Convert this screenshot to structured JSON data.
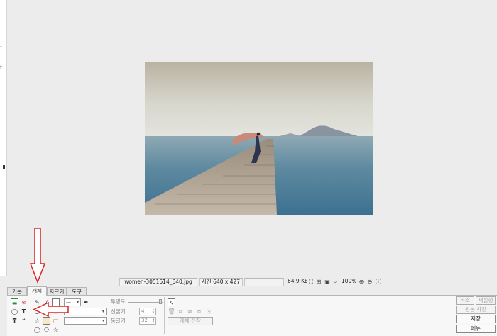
{
  "status": {
    "filename": "women-3051614_640.jpg",
    "dimensions": "사진 640 x 427",
    "filesize": "64.9 KB",
    "zoom": "100%"
  },
  "tabs": [
    {
      "label": "기본",
      "active": false
    },
    {
      "label": "개체",
      "active": true
    },
    {
      "label": "자르기",
      "active": false
    },
    {
      "label": "도구",
      "active": false
    }
  ],
  "panel": {
    "opacity_label": "투명도",
    "line_width_label": "선굵기",
    "line_width_value": "4",
    "rounding_label": "둥글기",
    "rounding_value": "32",
    "copy_object_button": "개체 전착"
  },
  "actions": {
    "cancel": "취소",
    "reapply": "재실행",
    "original_photo": "원본 사진",
    "save": "저장",
    "menu": "메뉴"
  },
  "colors": {
    "annotation_red": "#e02020",
    "accent_green": "#2e8b3a",
    "accent_pink": "#d0506a"
  }
}
